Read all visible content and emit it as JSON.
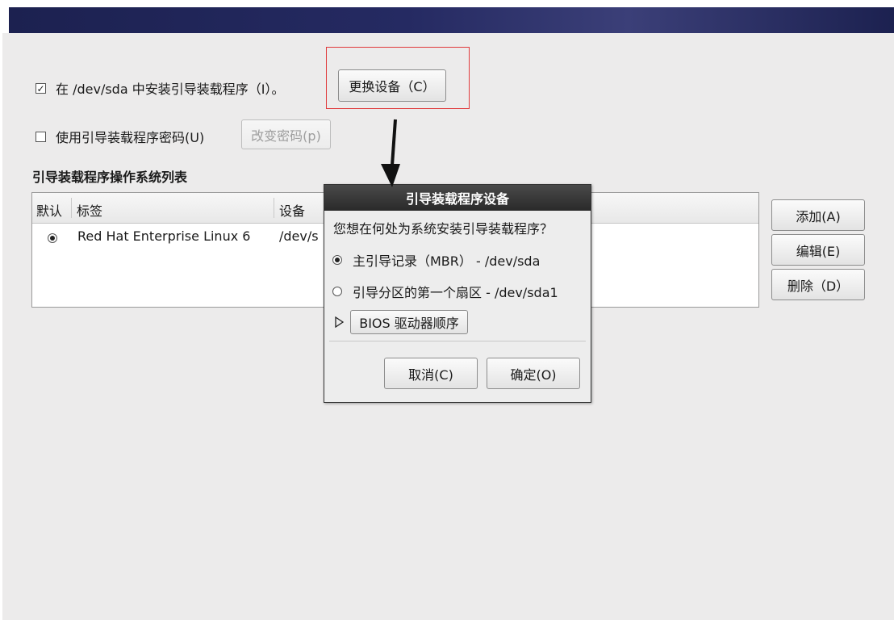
{
  "options": {
    "install_bootloader_label": "在 /dev/sda 中安装引导装载程序（I）。",
    "install_bootloader_checked": true,
    "change_device_button": "更换设备（C）",
    "use_password_label": "使用引导装载程序密码(U)",
    "use_password_checked": false,
    "change_password_button": "改变密码(p)"
  },
  "os_list": {
    "title": "引导装载程序操作系统列表",
    "columns": [
      "默认",
      "标签",
      "设备"
    ],
    "rows": [
      {
        "default": true,
        "label": "Red Hat Enterprise Linux 6",
        "device": "/dev/s"
      }
    ]
  },
  "side_buttons": {
    "add": "添加(A)",
    "edit": "编辑(E)",
    "delete": "删除（D）"
  },
  "dialog": {
    "title": "引导装载程序设备",
    "question": "您想在何处为系统安装引导装载程序？",
    "option_mbr": "主引导记录（MBR） - /dev/sda",
    "option_mbr_selected": true,
    "option_partition": "引导分区的第一个扇区 - /dev/sda1",
    "option_partition_selected": false,
    "bios_order_button": "BIOS 驱动器顺序",
    "cancel_button": "取消(C)",
    "ok_button": "确定(O)"
  },
  "annotation": {
    "highlight_color": "#e0393b",
    "arrow_color": "#111111"
  },
  "icons": {
    "check": "checkbox-checked-icon",
    "radio": "radio-button-icon",
    "expander": "expander-triangle-icon",
    "arrow": "annotation-arrow-icon"
  }
}
